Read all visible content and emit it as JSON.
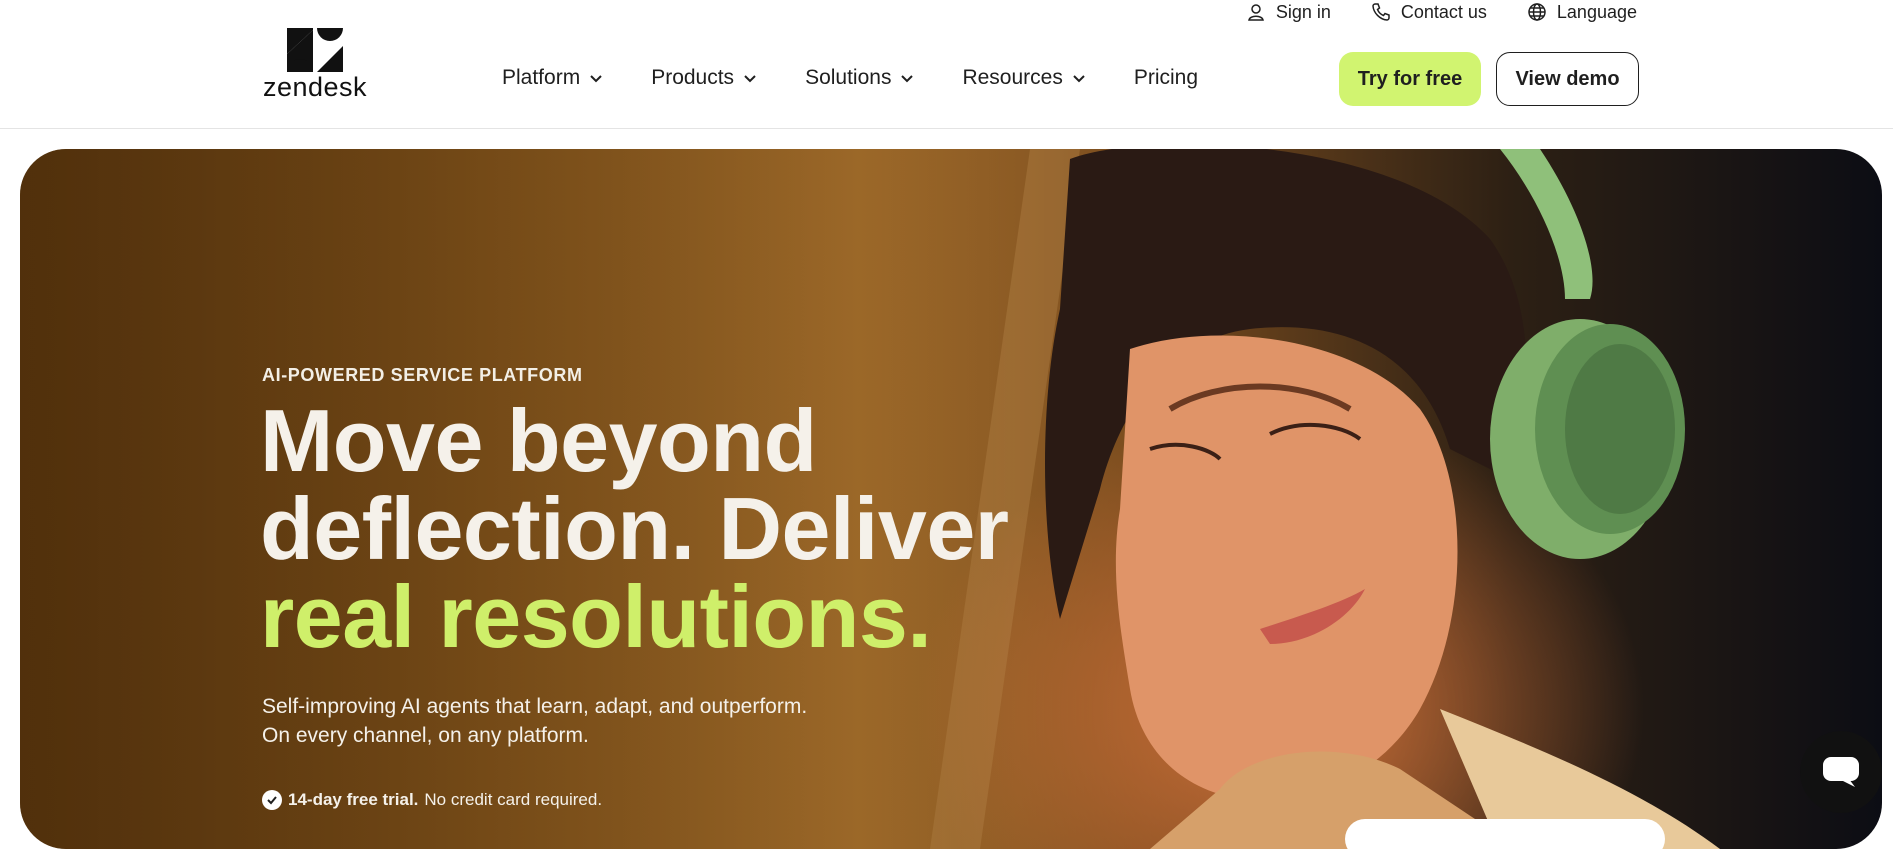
{
  "brand": {
    "name": "zendesk"
  },
  "utility_nav": {
    "sign_in": "Sign in",
    "contact_us": "Contact us",
    "language": "Language"
  },
  "main_nav": {
    "items": [
      {
        "label": "Platform",
        "icon": "chevron-down-icon"
      },
      {
        "label": "Products",
        "icon": "chevron-down-icon"
      },
      {
        "label": "Solutions",
        "icon": "chevron-down-icon"
      },
      {
        "label": "Resources",
        "icon": "chevron-down-icon"
      },
      {
        "label": "Pricing"
      }
    ]
  },
  "cta": {
    "try_free": "Try for free",
    "view_demo": "View demo"
  },
  "hero": {
    "eyebrow": "AI-POWERED SERVICE PLATFORM",
    "headline_line1": "Move beyond",
    "headline_line2": "deflection. Deliver",
    "headline_accent": "real resolutions.",
    "subtext_line1": "Self-improving AI agents that learn, adapt, and outperform.",
    "subtext_line2": "On every channel, on any platform.",
    "trial_bold": "14-day free trial.",
    "trial_rest": "No credit card required."
  },
  "colors": {
    "accent": "#d1f470",
    "headline_accent": "#cfef6a",
    "text_dark": "#1f1f1f"
  }
}
